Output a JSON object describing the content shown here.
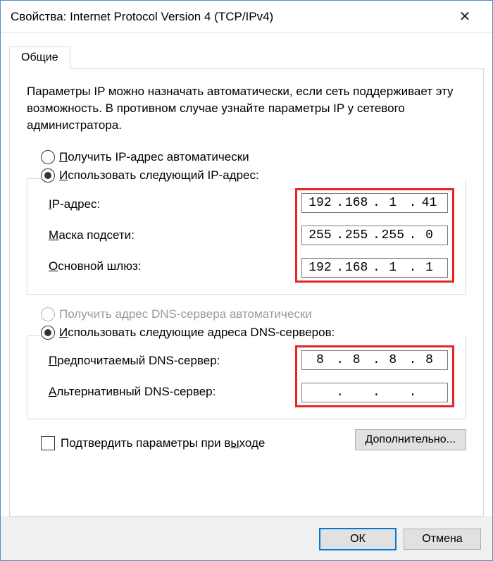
{
  "window": {
    "title": "Свойства: Internet Protocol Version 4 (TCP/IPv4)",
    "close": "✕"
  },
  "tab": {
    "general": "Общие"
  },
  "intro": "Параметры IP можно назначать автоматически, если сеть поддерживает эту возможность. В противном случае узнайте параметры IP у сетевого администратора.",
  "ip_section": {
    "auto_prefix": "П",
    "auto_rest": "олучить IP-адрес автоматически",
    "manual_prefix": "И",
    "manual_rest": "спользовать следующий IP-адрес:",
    "ip_label_u": "I",
    "ip_label_rest": "P-адрес:",
    "mask_label_u": "М",
    "mask_label_rest": "аска подсети:",
    "gw_label_u": "О",
    "gw_label_rest": "сновной шлюз:",
    "ip": {
      "o1": "192",
      "o2": "168",
      "o3": "1",
      "o4": "41"
    },
    "mask": {
      "o1": "255",
      "o2": "255",
      "o3": "255",
      "o4": "0"
    },
    "gw": {
      "o1": "192",
      "o2": "168",
      "o3": "1",
      "o4": "1"
    }
  },
  "dns_section": {
    "auto_prefix": "П",
    "auto_rest": "олучить адрес DNS-сервера автоматически",
    "manual_prefix": "И",
    "manual_rest": "спользовать следующие адреса DNS-серверов:",
    "pref_label_u": "П",
    "pref_label_rest": "редпочитаемый DNS-сервер:",
    "alt_label_u": "А",
    "alt_label_rest": "льтернативный DNS-сервер:",
    "pref": {
      "o1": "8",
      "o2": "8",
      "o3": "8",
      "o4": "8"
    },
    "alt": {
      "o1": "",
      "o2": "",
      "o3": "",
      "o4": ""
    }
  },
  "validate": {
    "text_pre": "Подтвердить параметры при в",
    "text_u": "ы",
    "text_post": "ходе"
  },
  "buttons": {
    "advanced_pre": "Д",
    "advanced_rest": "ополнительно...",
    "ok": "ОК",
    "cancel": "Отмена"
  }
}
